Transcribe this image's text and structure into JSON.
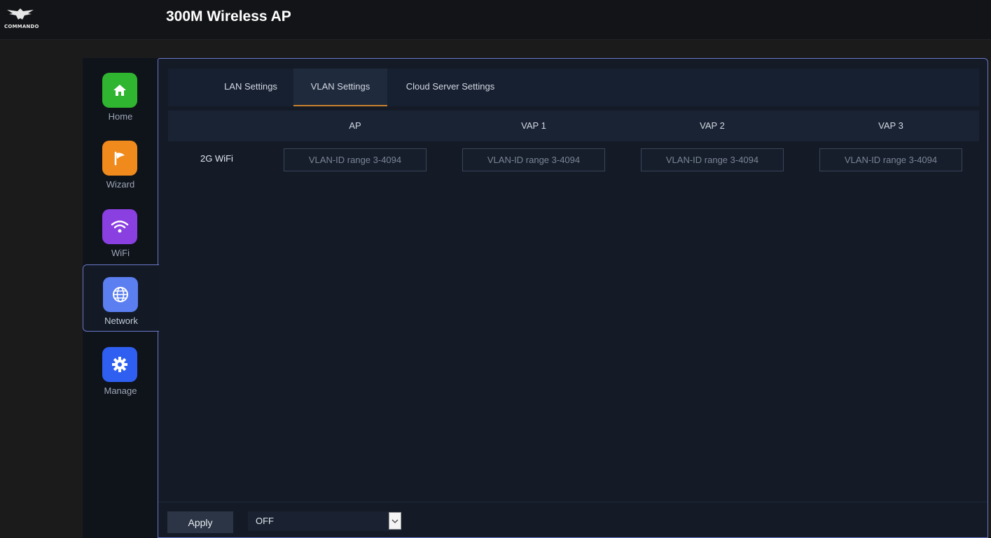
{
  "header": {
    "logo_text": "COMMANDO",
    "title": "300M Wireless AP"
  },
  "sidebar": {
    "items": [
      {
        "label": "Home",
        "icon": "home-icon",
        "color": "#2fb52f"
      },
      {
        "label": "Wizard",
        "icon": "flag-icon",
        "color": "#f08a1c"
      },
      {
        "label": "WiFi",
        "icon": "wifi-icon",
        "color": "#8a3fe0"
      },
      {
        "label": "Network",
        "icon": "globe-icon",
        "color": "#5b7ef0",
        "active": true
      },
      {
        "label": "Manage",
        "icon": "gear-icon",
        "color": "#2f5ff0"
      }
    ]
  },
  "tabs": [
    {
      "label": "LAN Settings"
    },
    {
      "label": "VLAN Settings",
      "active": true
    },
    {
      "label": "Cloud Server Settings"
    }
  ],
  "table": {
    "columns": [
      "AP",
      "VAP 1",
      "VAP 2",
      "VAP 3"
    ],
    "row_label": "2G WiFi",
    "inputs": [
      {
        "value": "",
        "placeholder": "VLAN-ID range 3-4094"
      },
      {
        "value": "",
        "placeholder": "VLAN-ID range 3-4094"
      },
      {
        "value": "",
        "placeholder": "VLAN-ID range 3-4094"
      },
      {
        "value": "",
        "placeholder": "VLAN-ID range 3-4094"
      }
    ]
  },
  "footer": {
    "apply_label": "Apply",
    "select_value": "OFF"
  },
  "colors": {
    "accent_border": "#6a78c8",
    "active_tab_underline": "#c8822e"
  }
}
